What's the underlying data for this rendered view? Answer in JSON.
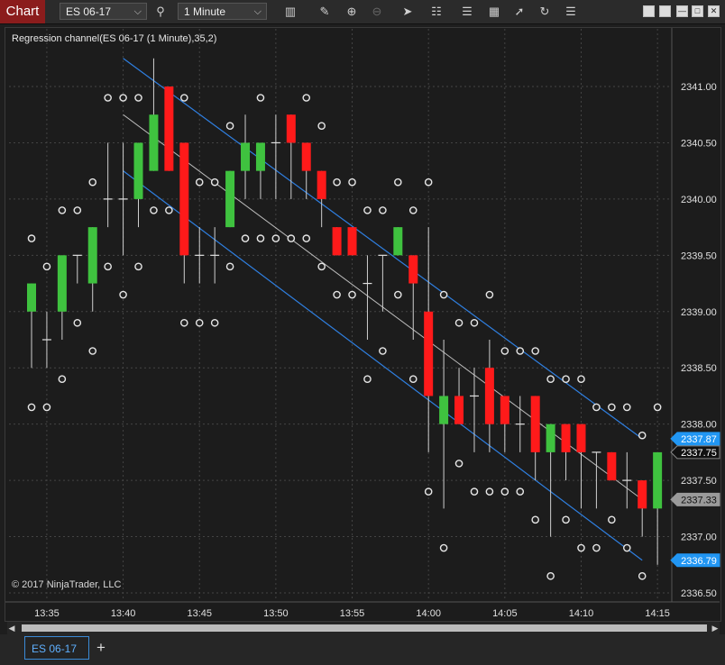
{
  "toolbar": {
    "brand": "Chart",
    "instrument": "ES 06-17",
    "interval": "1 Minute"
  },
  "chart": {
    "indicator_label": "Regression channel(ES 06-17 (1 Minute),35,2)",
    "copyright": "© 2017 NinjaTrader, LLC",
    "colors": {
      "up": "#3fc23f",
      "down": "#ff1a1a",
      "channel": "#2f7fe0",
      "midline": "#bdbdbd",
      "psar": "#e6e6e6"
    }
  },
  "chart_data": {
    "type": "candlestick",
    "xlabel": "",
    "ylabel": "",
    "ylim": [
      2336.5,
      2341.1
    ],
    "y_ticks": [
      "2341.00",
      "2340.50",
      "2340.00",
      "2339.50",
      "2339.00",
      "2338.50",
      "2338.00",
      "2337.50",
      "2337.00",
      "2336.50"
    ],
    "x_ticks": [
      "13:35",
      "13:40",
      "13:45",
      "13:50",
      "13:55",
      "14:00",
      "14:05",
      "14:10",
      "14:15"
    ],
    "grid": true,
    "price_markers": [
      {
        "label": "2337.87",
        "value": 2337.87,
        "color": "#2196f3"
      },
      {
        "label": "2337.75",
        "value": 2337.75,
        "color": "#111111"
      },
      {
        "label": "2337.33",
        "value": 2337.33,
        "color": "#9a9a9a"
      },
      {
        "label": "2336.79",
        "value": 2336.79,
        "color": "#2196f3"
      }
    ],
    "candles": [
      {
        "time": "13:34",
        "open": 2339.0,
        "high": 2339.25,
        "low": 2338.5,
        "close": 2339.25
      },
      {
        "time": "13:35",
        "open": 2338.75,
        "high": 2339.0,
        "low": 2338.5,
        "close": 2338.75
      },
      {
        "time": "13:36",
        "open": 2339.0,
        "high": 2339.5,
        "low": 2338.75,
        "close": 2339.5
      },
      {
        "time": "13:37",
        "open": 2339.5,
        "high": 2339.5,
        "low": 2339.25,
        "close": 2339.5
      },
      {
        "time": "13:38",
        "open": 2339.25,
        "high": 2339.75,
        "low": 2339.0,
        "close": 2339.75
      },
      {
        "time": "13:39",
        "open": 2340.0,
        "high": 2340.5,
        "low": 2339.75,
        "close": 2340.0
      },
      {
        "time": "13:40",
        "open": 2340.0,
        "high": 2340.5,
        "low": 2339.5,
        "close": 2340.0
      },
      {
        "time": "13:41",
        "open": 2340.0,
        "high": 2340.5,
        "low": 2339.75,
        "close": 2340.5
      },
      {
        "time": "13:42",
        "open": 2340.25,
        "high": 2341.25,
        "low": 2340.25,
        "close": 2340.75
      },
      {
        "time": "13:43",
        "open": 2341.0,
        "high": 2341.0,
        "low": 2340.25,
        "close": 2340.25
      },
      {
        "time": "13:44",
        "open": 2340.5,
        "high": 2340.5,
        "low": 2339.25,
        "close": 2339.5
      },
      {
        "time": "13:45",
        "open": 2339.5,
        "high": 2339.75,
        "low": 2339.25,
        "close": 2339.5
      },
      {
        "time": "13:46",
        "open": 2339.5,
        "high": 2339.75,
        "low": 2339.25,
        "close": 2339.5
      },
      {
        "time": "13:47",
        "open": 2339.75,
        "high": 2340.25,
        "low": 2339.75,
        "close": 2340.25
      },
      {
        "time": "13:48",
        "open": 2340.25,
        "high": 2340.75,
        "low": 2340.0,
        "close": 2340.5
      },
      {
        "time": "13:49",
        "open": 2340.25,
        "high": 2340.5,
        "low": 2340.0,
        "close": 2340.5
      },
      {
        "time": "13:50",
        "open": 2340.5,
        "high": 2340.75,
        "low": 2340.0,
        "close": 2340.5
      },
      {
        "time": "13:51",
        "open": 2340.75,
        "high": 2340.75,
        "low": 2340.0,
        "close": 2340.5
      },
      {
        "time": "13:52",
        "open": 2340.5,
        "high": 2340.5,
        "low": 2340.0,
        "close": 2340.25
      },
      {
        "time": "13:53",
        "open": 2340.25,
        "high": 2340.25,
        "low": 2339.75,
        "close": 2340.0
      },
      {
        "time": "13:54",
        "open": 2339.75,
        "high": 2339.75,
        "low": 2339.5,
        "close": 2339.5
      },
      {
        "time": "13:55",
        "open": 2339.75,
        "high": 2339.75,
        "low": 2339.5,
        "close": 2339.5
      },
      {
        "time": "13:56",
        "open": 2339.25,
        "high": 2339.5,
        "low": 2338.75,
        "close": 2339.25
      },
      {
        "time": "13:57",
        "open": 2339.5,
        "high": 2339.5,
        "low": 2339.0,
        "close": 2339.5
      },
      {
        "time": "13:58",
        "open": 2339.5,
        "high": 2339.75,
        "low": 2339.5,
        "close": 2339.75
      },
      {
        "time": "13:59",
        "open": 2339.5,
        "high": 2339.5,
        "low": 2338.75,
        "close": 2339.25
      },
      {
        "time": "14:00",
        "open": 2339.0,
        "high": 2339.75,
        "low": 2337.75,
        "close": 2338.25
      },
      {
        "time": "14:01",
        "open": 2338.0,
        "high": 2338.75,
        "low": 2337.25,
        "close": 2338.25
      },
      {
        "time": "14:02",
        "open": 2338.25,
        "high": 2338.5,
        "low": 2338.0,
        "close": 2338.0
      },
      {
        "time": "14:03",
        "open": 2338.25,
        "high": 2338.5,
        "low": 2337.75,
        "close": 2338.25
      },
      {
        "time": "14:04",
        "open": 2338.5,
        "high": 2338.75,
        "low": 2337.75,
        "close": 2338.0
      },
      {
        "time": "14:05",
        "open": 2338.25,
        "high": 2338.25,
        "low": 2337.75,
        "close": 2338.0
      },
      {
        "time": "14:06",
        "open": 2338.0,
        "high": 2338.25,
        "low": 2337.75,
        "close": 2338.0
      },
      {
        "time": "14:07",
        "open": 2338.25,
        "high": 2338.25,
        "low": 2337.5,
        "close": 2337.75
      },
      {
        "time": "14:08",
        "open": 2337.75,
        "high": 2338.0,
        "low": 2337.0,
        "close": 2338.0
      },
      {
        "time": "14:09",
        "open": 2338.0,
        "high": 2338.0,
        "low": 2337.5,
        "close": 2337.75
      },
      {
        "time": "14:10",
        "open": 2338.0,
        "high": 2338.0,
        "low": 2337.25,
        "close": 2337.75
      },
      {
        "time": "14:11",
        "open": 2337.75,
        "high": 2337.75,
        "low": 2337.25,
        "close": 2337.75
      },
      {
        "time": "14:12",
        "open": 2337.75,
        "high": 2337.75,
        "low": 2337.5,
        "close": 2337.5
      },
      {
        "time": "14:13",
        "open": 2337.5,
        "high": 2337.75,
        "low": 2337.25,
        "close": 2337.5
      },
      {
        "time": "14:14",
        "open": 2337.5,
        "high": 2337.5,
        "low": 2337.0,
        "close": 2337.25
      },
      {
        "time": "14:15",
        "open": 2337.25,
        "high": 2337.75,
        "low": 2336.75,
        "close": 2337.75
      }
    ],
    "regression_channel": {
      "middle": {
        "start": 2340.75,
        "end": 2337.33
      },
      "upper": {
        "start": 2341.25,
        "end": 2337.87
      },
      "lower": {
        "start": 2340.25,
        "end": 2336.79
      }
    }
  },
  "tabbar": {
    "tab_label": "ES 06-17",
    "add_label": "+"
  }
}
